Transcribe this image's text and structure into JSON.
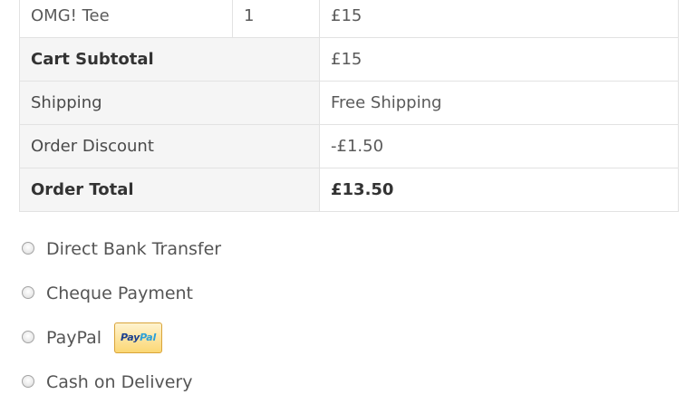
{
  "order_summary": {
    "item": {
      "name": "OMG! Tee",
      "quantity": "1",
      "total": "£15"
    },
    "cart_subtotal": {
      "label": "Cart Subtotal",
      "value": "£15"
    },
    "shipping": {
      "label": "Shipping",
      "value": "Free Shipping"
    },
    "order_discount": {
      "label": "Order Discount",
      "value": "-£1.50"
    },
    "order_total": {
      "label": "Order Total",
      "value": "£13.50"
    }
  },
  "payment": {
    "methods": [
      {
        "label": "Direct Bank Transfer",
        "selected": false
      },
      {
        "label": "Cheque Payment",
        "selected": false
      },
      {
        "label": "PayPal",
        "selected": false,
        "badge": {
          "text_part1": "Pay",
          "text_part2": "Pal",
          "icon": "paypal-logo"
        }
      },
      {
        "label": "Cash on Delivery",
        "selected": false
      }
    ]
  },
  "colors": {
    "table_border": "#e2e2e2",
    "label_background": "#f5f5f5",
    "paypal_dark_blue": "#1a3f8f",
    "paypal_light_blue": "#2b9fd9",
    "paypal_badge_gold": "#fbd774"
  }
}
